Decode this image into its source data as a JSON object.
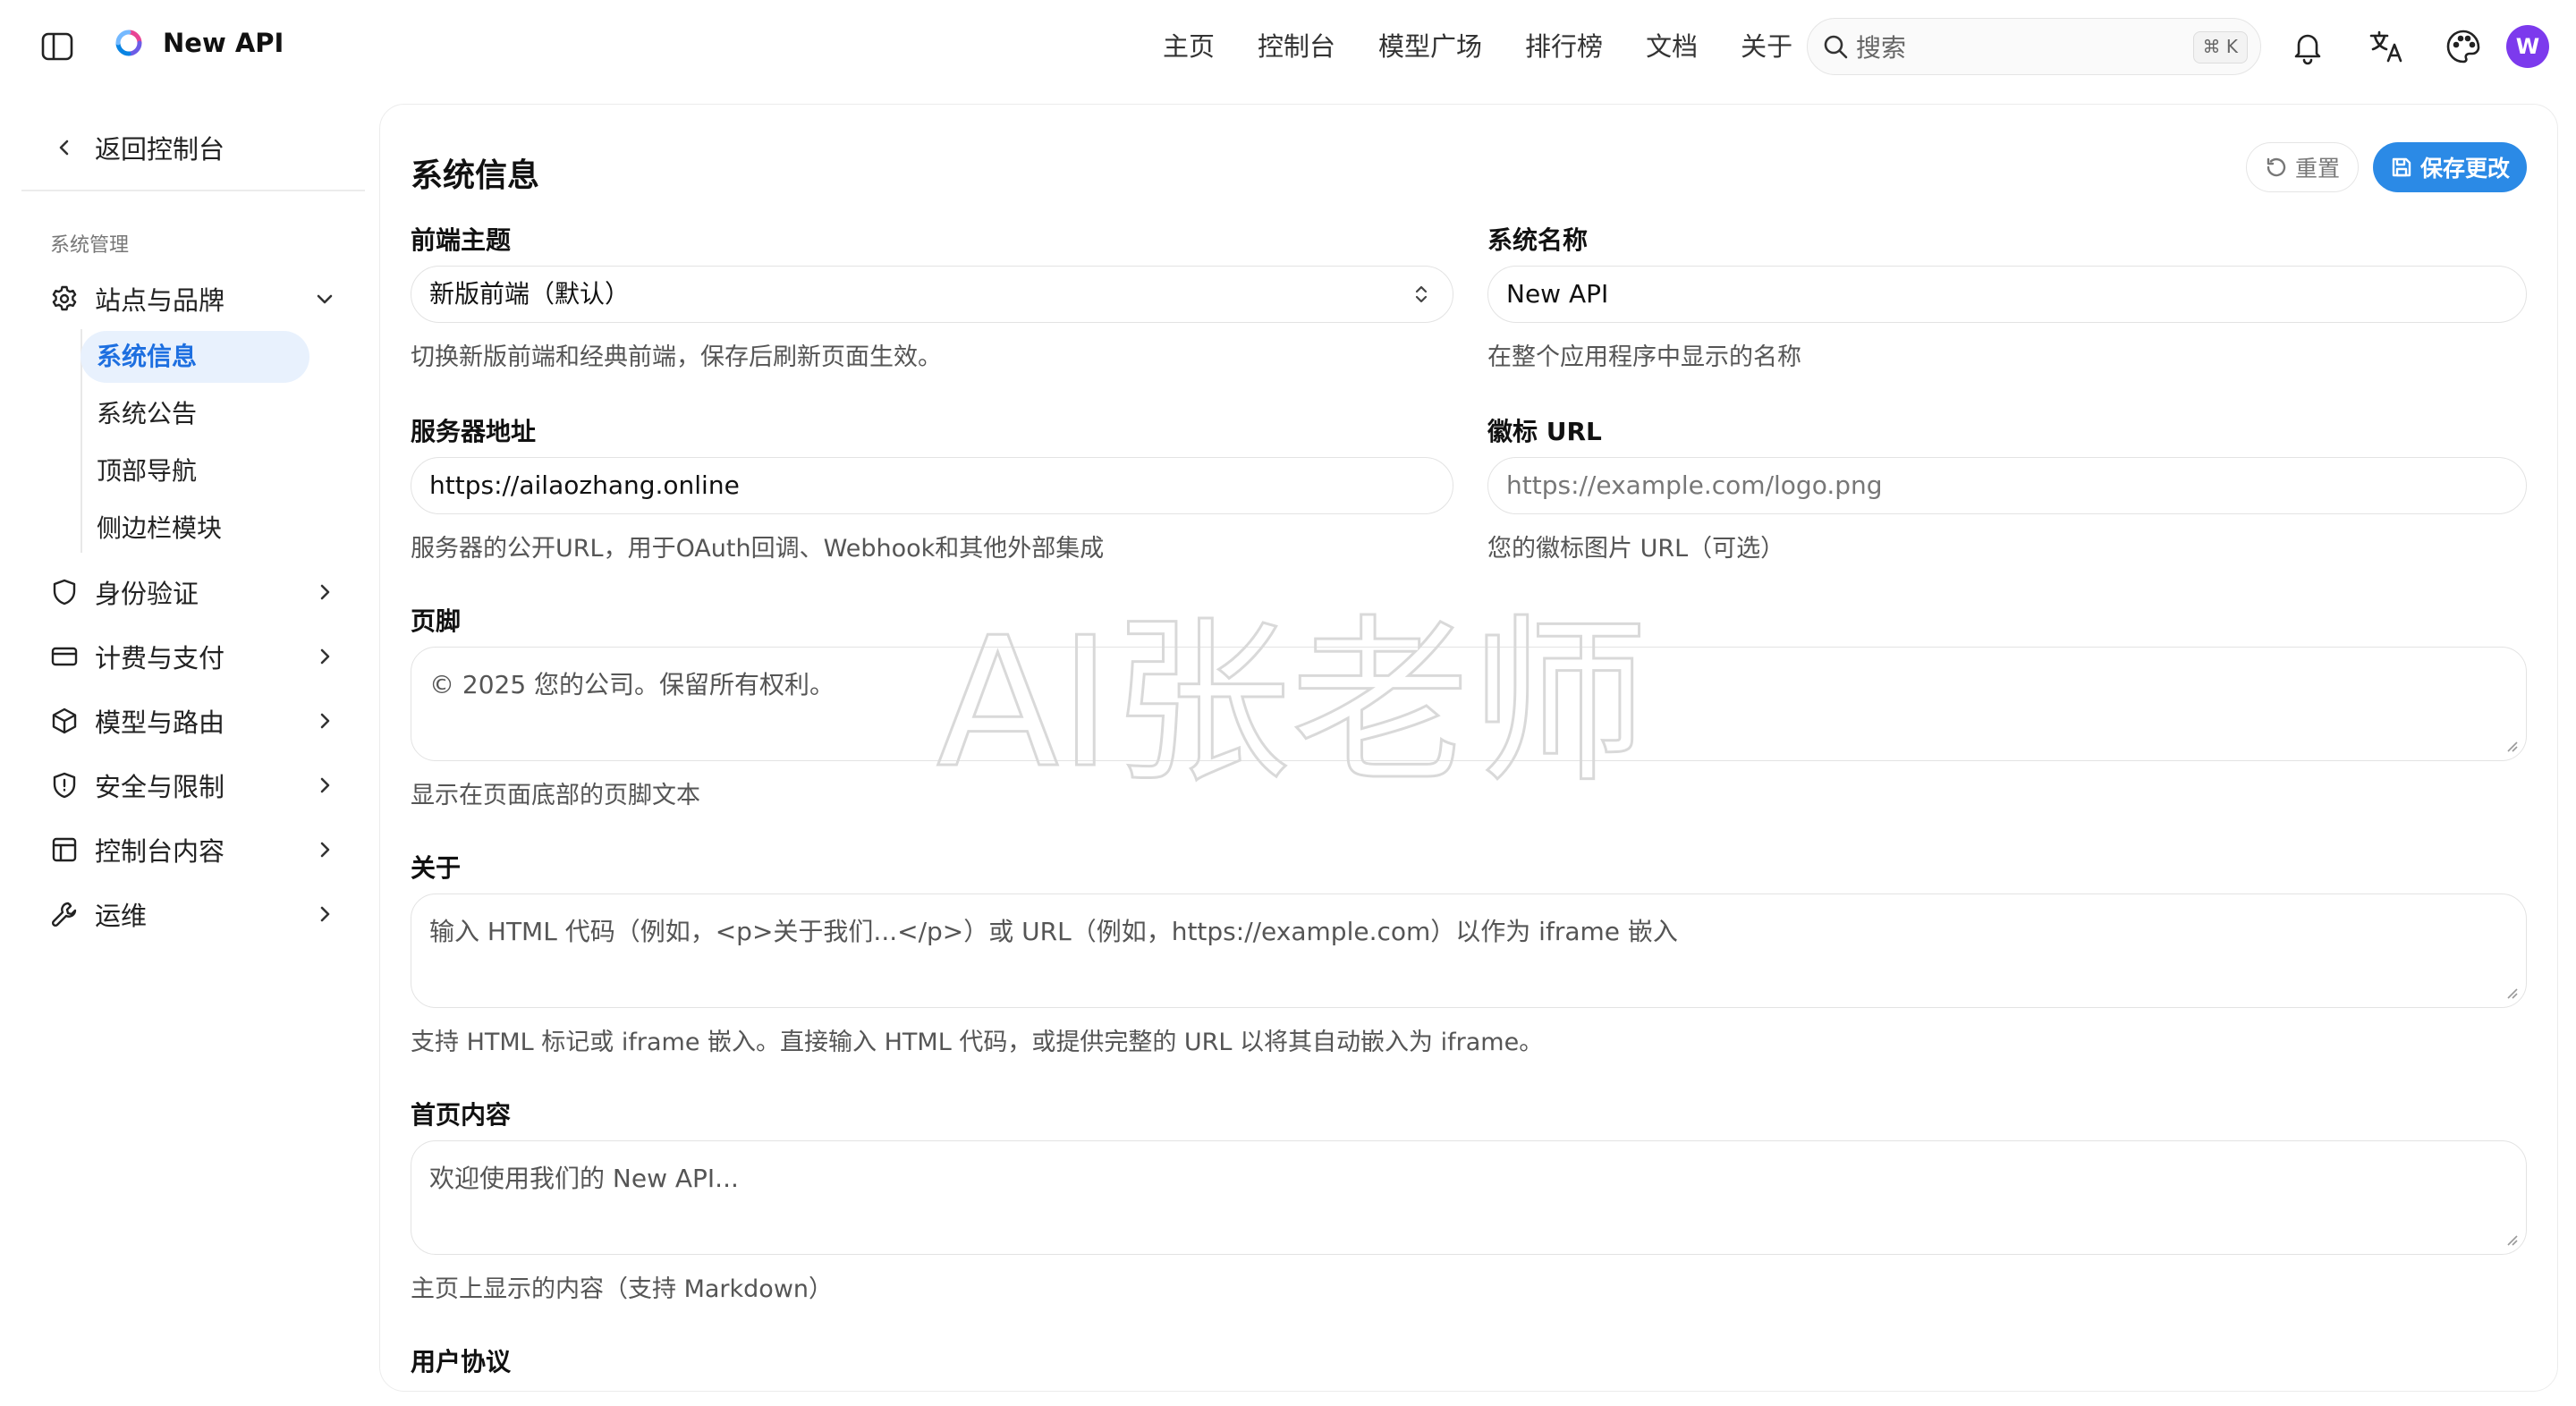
{
  "app": {
    "name": "New API"
  },
  "nav": {
    "items": [
      "主页",
      "控制台",
      "模型广场",
      "排行榜",
      "文档",
      "关于"
    ],
    "search_placeholder": "搜索",
    "search_shortcut": "⌘ K",
    "avatar_initial": "W"
  },
  "sidebar": {
    "back_label": "返回控制台",
    "section_label": "系统管理",
    "groups": [
      {
        "label": "站点与品牌",
        "icon": "gear-icon",
        "expanded": true
      },
      {
        "label": "身份验证",
        "icon": "shield-icon"
      },
      {
        "label": "计费与支付",
        "icon": "credit-card-icon"
      },
      {
        "label": "模型与路由",
        "icon": "cube-icon"
      },
      {
        "label": "安全与限制",
        "icon": "shield-alert-icon"
      },
      {
        "label": "控制台内容",
        "icon": "layout-icon"
      },
      {
        "label": "运维",
        "icon": "wrench-icon"
      }
    ],
    "subitems": [
      "系统信息",
      "系统公告",
      "顶部导航",
      "侧边栏模块"
    ],
    "active_subitem": "系统信息"
  },
  "main": {
    "title": "系统信息",
    "reset_label": "重置",
    "save_label": "保存更改",
    "fields": {
      "frontend_theme": {
        "label": "前端主题",
        "value": "新版前端（默认）",
        "help": "切换新版前端和经典前端，保存后刷新页面生效。"
      },
      "system_name": {
        "label": "系统名称",
        "value": "New API",
        "help": "在整个应用程序中显示的名称"
      },
      "server_address": {
        "label": "服务器地址",
        "value": "https://ailaozhang.online",
        "help": "服务器的公开URL，用于OAuth回调、Webhook和其他外部集成"
      },
      "logo_url": {
        "label": "徽标 URL",
        "placeholder": "https://example.com/logo.png",
        "help": "您的徽标图片 URL（可选）"
      },
      "footer": {
        "label": "页脚",
        "placeholder": "© 2025 您的公司。保留所有权利。",
        "help": "显示在页面底部的页脚文本"
      },
      "about": {
        "label": "关于",
        "placeholder": "输入 HTML 代码（例如，<p>关于我们...</p>）或 URL（例如，https://example.com）以作为 iframe 嵌入",
        "help": "支持 HTML 标记或 iframe 嵌入。直接输入 HTML 代码，或提供完整的 URL 以将其自动嵌入为 iframe。"
      },
      "home_content": {
        "label": "首页内容",
        "placeholder": "欢迎使用我们的 New API...",
        "help": "主页上显示的内容（支持 Markdown）"
      },
      "user_agreement": {
        "label": "用户协议"
      }
    }
  },
  "watermark": {
    "text": "AI张老师"
  },
  "colors": {
    "accent": "#2b8ae6",
    "active_bg": "#e8f1fd",
    "avatar": "#7c3aed"
  }
}
